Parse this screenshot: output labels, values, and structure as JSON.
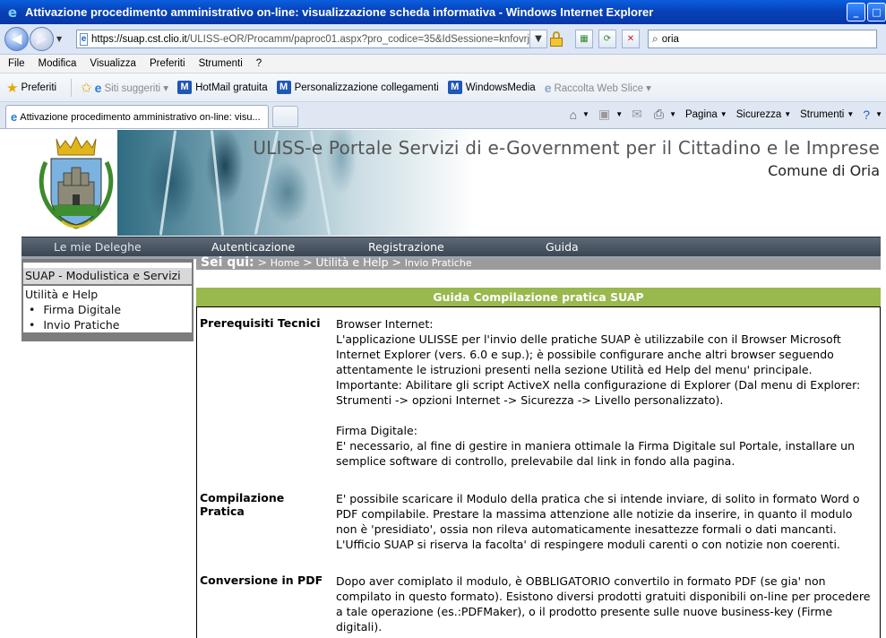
{
  "window": {
    "title": "Attivazione procedimento amministrativo on-line: visualizzazione scheda informativa - Windows Internet Explorer",
    "controls": {
      "minimize": "_",
      "maximize": "□"
    }
  },
  "address": {
    "url_host": "https://suap.cst.clio.it",
    "url_rest": "/ULISS-eOR/Procamm/paproc01.aspx?pro_codice=35&IdSessione=knfovrjfbg",
    "search_value": "oria"
  },
  "menu": [
    "File",
    "Modifica",
    "Visualizza",
    "Preferiti",
    "Strumenti",
    "?"
  ],
  "favorites": {
    "label": "Preferiti",
    "items": [
      {
        "label": "Siti suggeriti ▾",
        "icon": "ie-icon",
        "dimmed": true
      },
      {
        "label": "HotMail gratuita",
        "icon": "msn-icon",
        "dimmed": false
      },
      {
        "label": "Personalizzazione collegamenti",
        "icon": "msn-icon",
        "dimmed": false
      },
      {
        "label": "WindowsMedia",
        "icon": "msn-icon",
        "dimmed": false
      },
      {
        "label": "Raccolta Web Slice ▾",
        "icon": "webslice-icon",
        "dimmed": true
      }
    ]
  },
  "tab": {
    "label": "Attivazione procedimento amministrativo on-line: visu..."
  },
  "commandbar": {
    "page": "Pagina",
    "security": "Sicurezza",
    "tools": "Strumenti"
  },
  "site": {
    "title": "ULISS-e Portale Servizi di e-Government per il Cittadino e le Imprese",
    "subtitle": "Comune di Oria",
    "nav": [
      "Le mie Deleghe",
      "Autenticazione",
      "Registrazione",
      "Guida"
    ]
  },
  "sidebar": {
    "header": "SUAP - Modulistica e Servizi",
    "section": "Utilità e Help",
    "items": [
      "Firma Digitale",
      "Invio Pratiche"
    ]
  },
  "breadcrumb": {
    "label": "Sei qui:",
    "sep": ">",
    "home": "Home",
    "section": "Utilità e Help",
    "current": "Invio Pratiche"
  },
  "guide": {
    "title": "Guida Compilazione pratica SUAP",
    "rows": [
      {
        "label": "Prerequisiti Tecnici",
        "paragraphs": [
          "Browser Internet:",
          "L'applicazione ULISSE per l'invio delle pratiche SUAP è utilizzabile con il Browser Microsoft Internet Explorer (vers. 6.0 e sup.); è possibile configurare anche altri browser seguendo attentamente le istruzioni presenti nella sezione Utilità ed Help del menu' principale.",
          "Importante: Abilitare gli script ActiveX nella configurazione di Explorer (Dal menu di Explorer: Strumenti -> opzioni Internet -> Sicurezza -> Livello personalizzato).",
          "",
          "Firma Digitale:",
          "E' necessario, al fine di gestire in maniera ottimale la Firma Digitale sul Portale, installare un semplice software di controllo, prelevabile dal link in fondo alla pagina."
        ]
      },
      {
        "label": "Compilazione Pratica",
        "paragraphs": [
          "E' possibile scaricare il Modulo della pratica che si intende inviare, di solito in formato Word o PDF compilabile. Prestare la massima attenzione alle notizie da inserire, in quanto il modulo non è 'presidiato', ossia non rileva automaticamente inesattezze formali o dati mancanti. L'Ufficio SUAP si riserva la facolta' di respingere moduli carenti o con notizie non coerenti."
        ]
      },
      {
        "label": "Conversione in PDF",
        "paragraphs": [
          "Dopo aver comiplato il modulo, è OBBLIGATORIO convertilo in formato PDF (se gia' non compilato in questo formato). Esistono diversi prodotti gratuiti disponibili on-line per procedere a tale operazione (es.:PDFMaker), o il prodotto presente sulle nuove business-key (Firme digitali)."
        ]
      }
    ]
  }
}
